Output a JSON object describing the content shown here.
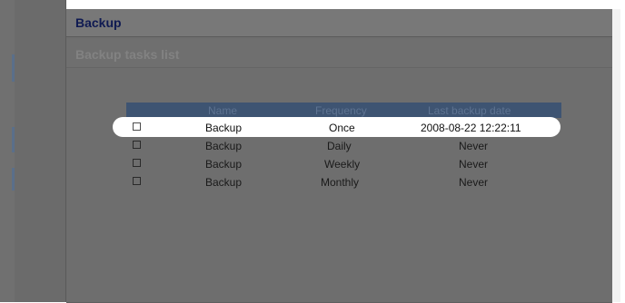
{
  "window": {
    "title": "Backup"
  },
  "section": {
    "title": "Backup tasks list"
  },
  "table": {
    "columns": [
      "Name",
      "Frequency",
      "Last backup date"
    ],
    "rows": [
      {
        "name": "Backup",
        "frequency": "Once",
        "last_backup": "2008-08-22 12:22:11",
        "checked": false,
        "selected": true
      },
      {
        "name": "Backup",
        "frequency": "Daily",
        "last_backup": "Never",
        "checked": false,
        "selected": false
      },
      {
        "name": "Backup",
        "frequency": "Weekly",
        "last_backup": "Never",
        "checked": false,
        "selected": false
      },
      {
        "name": "Backup",
        "frequency": "Monthly",
        "last_backup": "Never",
        "checked": false,
        "selected": false
      }
    ]
  },
  "colors": {
    "title_text": "#0f1a52",
    "header_bg": "#3e5472",
    "overlay": "#6e6e6e",
    "highlight": "#ffffff"
  }
}
